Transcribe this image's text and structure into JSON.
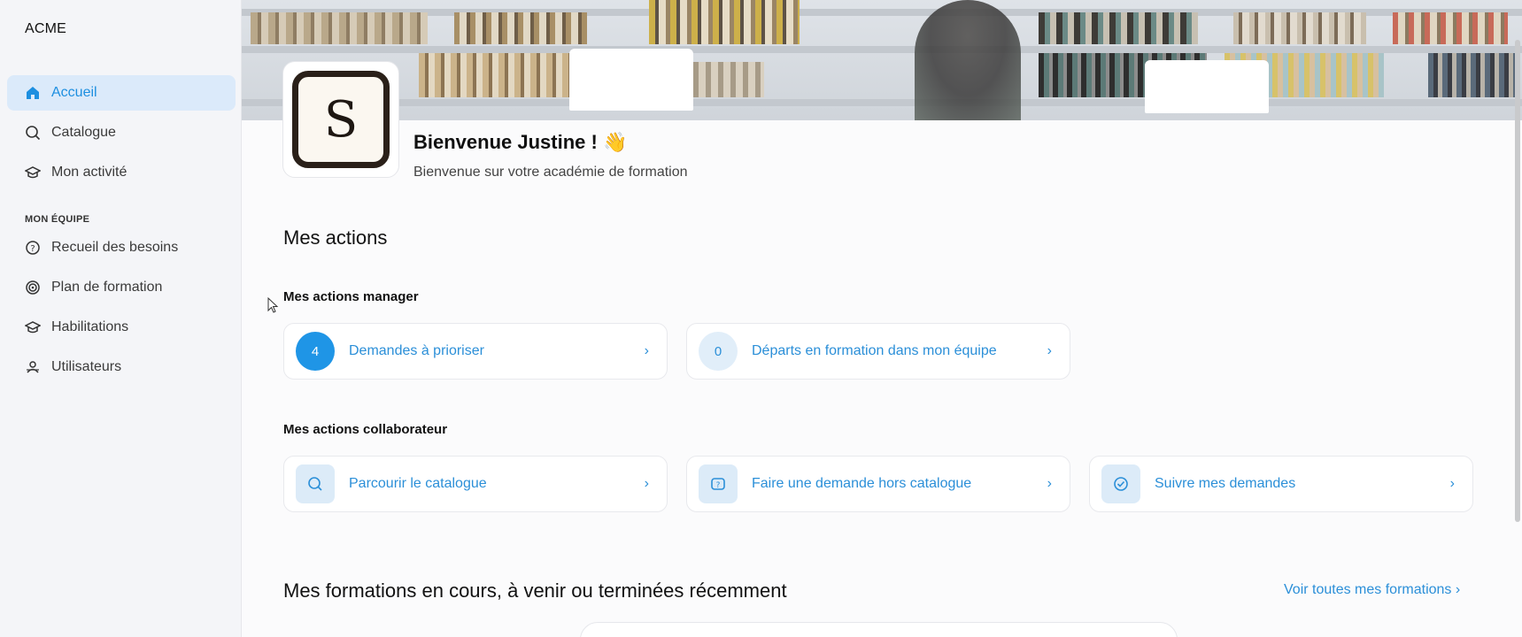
{
  "app": {
    "brand": "ACME"
  },
  "sidebar": {
    "items": [
      {
        "label": "Accueil",
        "icon": "home-icon",
        "active": true
      },
      {
        "label": "Catalogue",
        "icon": "search-icon"
      },
      {
        "label": "Mon activité",
        "icon": "graduation-cap-icon"
      }
    ],
    "team_section": "MON ÉQUIPE",
    "team_items": [
      {
        "label": "Recueil des besoins",
        "icon": "question-circle-icon"
      },
      {
        "label": "Plan de formation",
        "icon": "target-icon"
      },
      {
        "label": "Habilitations",
        "icon": "graduation-cap-icon"
      },
      {
        "label": "Utilisateurs",
        "icon": "users-icon"
      }
    ]
  },
  "header": {
    "logo_letter": "S",
    "welcome": "Bienvenue Justine ! 👋",
    "subtitle": "Bienvenue sur votre académie de formation"
  },
  "actions": {
    "title": "Mes actions",
    "manager_title": "Mes actions manager",
    "manager": [
      {
        "count": "4",
        "label": "Demandes à prioriser"
      },
      {
        "count": "0",
        "label": "Départs en formation dans mon équipe"
      }
    ],
    "collab_title": "Mes actions collaborateur",
    "collaborator": [
      {
        "label": "Parcourir le catalogue",
        "icon": "search-icon"
      },
      {
        "label": "Faire une demande hors catalogue",
        "icon": "question-badge-icon"
      },
      {
        "label": "Suivre mes demandes",
        "icon": "check-circle-icon"
      }
    ]
  },
  "trainings": {
    "title": "Mes formations en cours, à venir ou terminées récemment",
    "see_all": "Voir toutes mes formations"
  },
  "chevron": "›",
  "colors": {
    "accent": "#1f95e6",
    "active_bg": "#dbeafa"
  }
}
